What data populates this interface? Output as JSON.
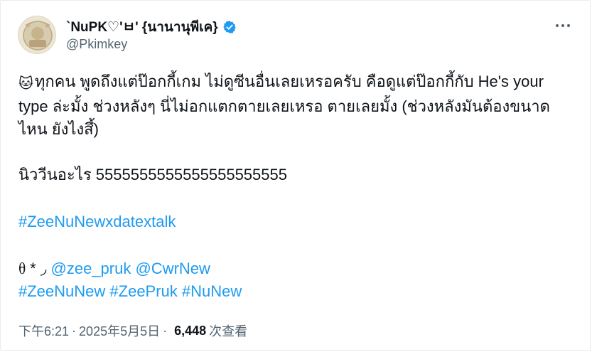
{
  "author": {
    "display_name": "`NuPK♡'ㅂ' {นานานุพีเค}",
    "handle": "@Pkimkey",
    "verified_color": "#1d9bf0"
  },
  "tweet": {
    "line1_emoji": "🐱",
    "paragraph1": "ทุกคน พูดถึงแต่ป๊อกกี้เกม ไม่ดูซีนอื่นเลยเหรอครับ คือดูแต่ป๊อกกี้กับ He's your type ล่ะมั้ง ช่วงหลังๆ นี่ไม่อกแตกตายเลยเหรอ ตายเลยมั้ง (ช่วงหลังมันต้องขนาดไหน ยังไงสึ้)",
    "paragraph2": "นิววีนอะไร 5555555555555555555555",
    "hashtag1": "#ZeeNuNewxdatextalk",
    "mention_prefix": "ᦲ * ◞",
    "mention1": "@zee_pruk",
    "mention2": "@CwrNew",
    "hashtag2": "#ZeeNuNew",
    "hashtag3": "#ZeePruk",
    "hashtag4": "#NuNew"
  },
  "meta": {
    "time": "下午6:21",
    "date": "2025年5月5日",
    "views_count": "6,448",
    "views_label": "次查看"
  },
  "colors": {
    "link": "#1d9bf0",
    "secondary_text": "#536471",
    "primary_text": "#0f1419"
  },
  "icons": {
    "more": "more-horizontal-icon",
    "verified": "verified-badge-icon"
  }
}
